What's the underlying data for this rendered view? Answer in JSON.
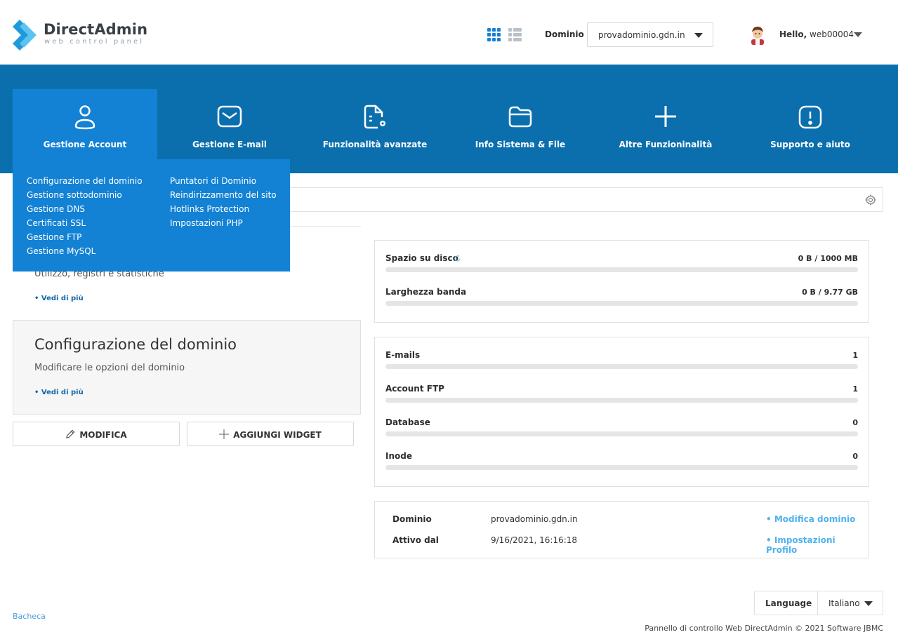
{
  "header": {
    "logo_title": "DirectAdmin",
    "logo_subtitle": "web control panel",
    "domain_label": "Dominio",
    "domain_value": "provadominio.gdn.in",
    "hello_prefix": "Hello,",
    "username": "web00004"
  },
  "nav": {
    "items": [
      {
        "label": "Gestione Account",
        "icon": "user-icon",
        "active": true
      },
      {
        "label": "Gestione E-mail",
        "icon": "mail-icon",
        "active": false
      },
      {
        "label": "Funzionalità avanzate",
        "icon": "file-settings-icon",
        "active": false
      },
      {
        "label": "Info Sistema & File",
        "icon": "folder-icon",
        "active": false
      },
      {
        "label": "Altre Funzioninalità",
        "icon": "plus-icon",
        "active": false
      },
      {
        "label": "Supporto e aiuto",
        "icon": "alert-icon",
        "active": false
      }
    ]
  },
  "dropdown": {
    "col1": [
      "Configurazione del dominio",
      "Gestione sottodominio",
      "Gestione DNS",
      "Certificati SSL",
      "Gestione FTP",
      "Gestione MySQL"
    ],
    "col2": [
      "Puntatori di Dominio",
      "Reindirizzamento del sito",
      "Hotlinks Protection",
      "Impostazioni PHP"
    ]
  },
  "widgets": {
    "w1": {
      "desc": "Utilizzo, registri e statistiche",
      "more": "• Vedi di più"
    },
    "w2": {
      "title": "Configurazione del dominio",
      "desc": "Modificare le opzioni del dominio",
      "more": "• Vedi di più"
    },
    "edit_label": "MODIFICA",
    "add_label": "AGGIUNGI WIDGET"
  },
  "stats": {
    "disk": {
      "name": "Spazio su disco",
      "value": "0 B / 1000 MB",
      "fraction": 0
    },
    "bandwidth": {
      "name": "Larghezza banda",
      "value": "0 B / 9.77 GB",
      "fraction": 0
    },
    "emails": {
      "name": "E-mails",
      "value": "1",
      "fraction": 0
    },
    "ftp": {
      "name": "Account FTP",
      "value": "1",
      "fraction": 0
    },
    "database": {
      "name": "Database",
      "value": "0",
      "fraction": 0
    },
    "inode": {
      "name": "Inode",
      "value": "0",
      "fraction": 0
    }
  },
  "info": {
    "domain_label": "Dominio",
    "domain_value": "provadominio.gdn.in",
    "since_label": "Attivo dal",
    "since_value": "9/16/2021, 16:16:18",
    "link_domain": "• Modifica dominio",
    "link_profile": "• Impostazioni Profilo"
  },
  "footer": {
    "breadcrumb": "Bacheca",
    "language_label": "Language",
    "language_value": "Italiano",
    "copyright": "Pannello di controllo Web DirectAdmin © 2021 Software JBMC"
  },
  "colors": {
    "nav_bg": "#0b6fae",
    "nav_active": "#1382d5",
    "link": "#4fb2ec",
    "bar_track": "#e5e5e5"
  }
}
